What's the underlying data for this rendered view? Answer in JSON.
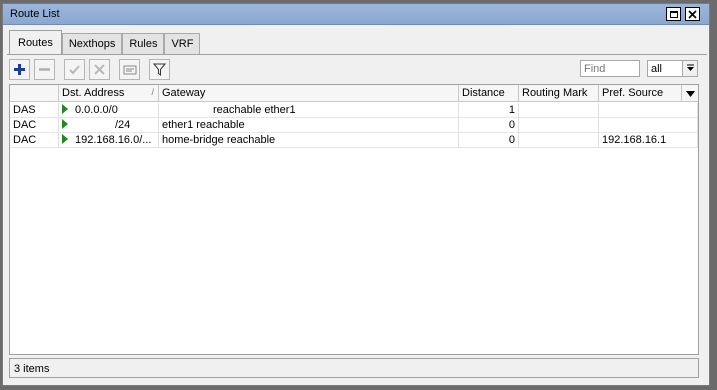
{
  "window": {
    "title": "Route List"
  },
  "tabs": [
    {
      "label": "Routes",
      "active": true
    },
    {
      "label": "Nexthops",
      "active": false
    },
    {
      "label": "Rules",
      "active": false
    },
    {
      "label": "VRF",
      "active": false
    }
  ],
  "toolbar": {
    "find_placeholder": "Find",
    "filter_value": "all"
  },
  "columns": [
    "",
    "Dst. Address",
    "Gateway",
    "Distance",
    "Routing Mark",
    "Pref. Source"
  ],
  "rows": [
    {
      "flags": "DAS",
      "dst": "0.0.0.0/0",
      "gateway": "reachable ether1",
      "distance": "1",
      "routing_mark": "",
      "pref_source": ""
    },
    {
      "flags": "DAC",
      "dst": "/24",
      "gateway": "ether1 reachable",
      "distance": "0",
      "routing_mark": "",
      "pref_source": ""
    },
    {
      "flags": "DAC",
      "dst": "192.168.16.0/...",
      "gateway": "home-bridge reachable",
      "distance": "0",
      "routing_mark": "",
      "pref_source": "192.168.16.1"
    }
  ],
  "status": {
    "count": "3 items"
  },
  "colors": {
    "titlebar": "#9bb6da",
    "add_icon": "#1a3d9c",
    "active_flag": "#1f8a1f"
  }
}
